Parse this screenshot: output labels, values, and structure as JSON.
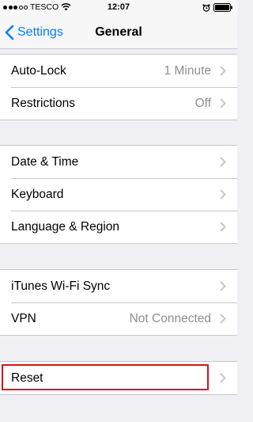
{
  "status_bar": {
    "carrier": "TESCO",
    "time": "12:07",
    "signal_bars": 5,
    "signal_filled": 3
  },
  "nav": {
    "back_label": "Settings",
    "title": "General"
  },
  "groups": [
    {
      "rows": [
        {
          "label": "Auto-Lock",
          "value": "1 Minute"
        },
        {
          "label": "Restrictions",
          "value": "Off"
        }
      ]
    },
    {
      "rows": [
        {
          "label": "Date & Time",
          "value": ""
        },
        {
          "label": "Keyboard",
          "value": ""
        },
        {
          "label": "Language & Region",
          "value": ""
        }
      ]
    },
    {
      "rows": [
        {
          "label": "iTunes Wi-Fi Sync",
          "value": ""
        },
        {
          "label": "VPN",
          "value": "Not Connected"
        }
      ]
    },
    {
      "rows": [
        {
          "label": "Reset",
          "value": ""
        }
      ]
    }
  ],
  "colors": {
    "accent": "#0a7bff",
    "highlight": "#d6121a",
    "background": "#efeff4",
    "secondary_text": "#8e8e93"
  }
}
